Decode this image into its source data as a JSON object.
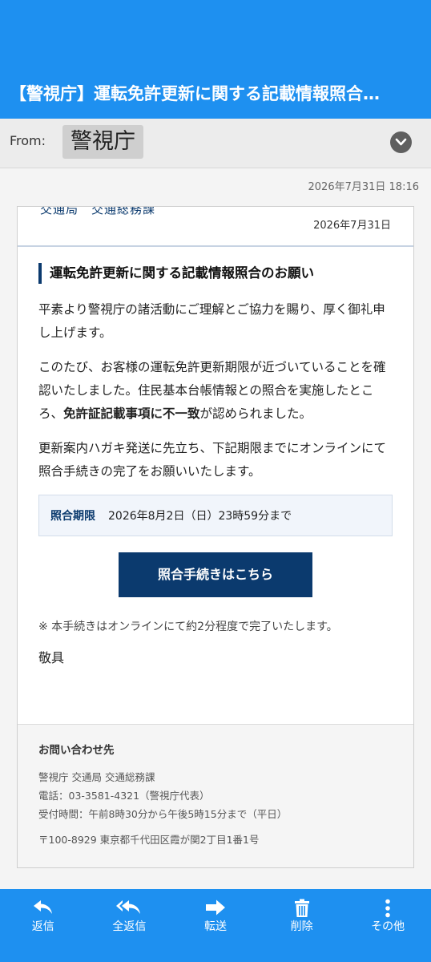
{
  "header": {
    "subject": "【警視庁】運転免許更新に関する記載情報照合…"
  },
  "from": {
    "label": "From:",
    "sender": "警視庁"
  },
  "received": "2026年7月31日 18:16",
  "card": {
    "dept": "交通局　交通総務課",
    "date": "2026年7月31日",
    "title": "運転免許更新に関する記載情報照合のお願い",
    "p1": "平素より警視庁の諸活動にご理解とご協力を賜り、厚く御礼申し上げます。",
    "p2a": "このたび、お客様の運転免許更新期限が近づいていることを確認いたしました。住民基本台帳情報との照合を実施したところ、",
    "p2b": "免許証記載事項に不一致",
    "p2c": "が認められました。",
    "p3": "更新案内ハガキ発送に先立ち、下記期限までにオンラインにて照合手続きの完了をお願いいたします。",
    "deadline_label": "照合期限",
    "deadline_value": "2026年8月2日（日）23時59分まで",
    "cta": "照合手続きはこちら",
    "note": "※ 本手続きはオンラインにて約2分程度で完了いたします。",
    "closing": "敬具"
  },
  "contact": {
    "heading": "お問い合わせ先",
    "org": "警視庁 交通局 交通総務課",
    "phone": "電話：03-3581-4321（警視庁代表）",
    "hours": "受付時間：午前8時30分から午後5時15分まで（平日）",
    "address": "〒100-8929 東京都千代田区霞が関2丁目1番1号"
  },
  "toolbar": [
    {
      "label": "返信",
      "icon": "reply-icon"
    },
    {
      "label": "全返信",
      "icon": "reply-all-icon"
    },
    {
      "label": "転送",
      "icon": "forward-icon"
    },
    {
      "label": "削除",
      "icon": "trash-icon"
    },
    {
      "label": "その他",
      "icon": "more-vertical-icon"
    }
  ],
  "colors": {
    "header": "#1e90f0",
    "navy": "#0b3a6e"
  }
}
